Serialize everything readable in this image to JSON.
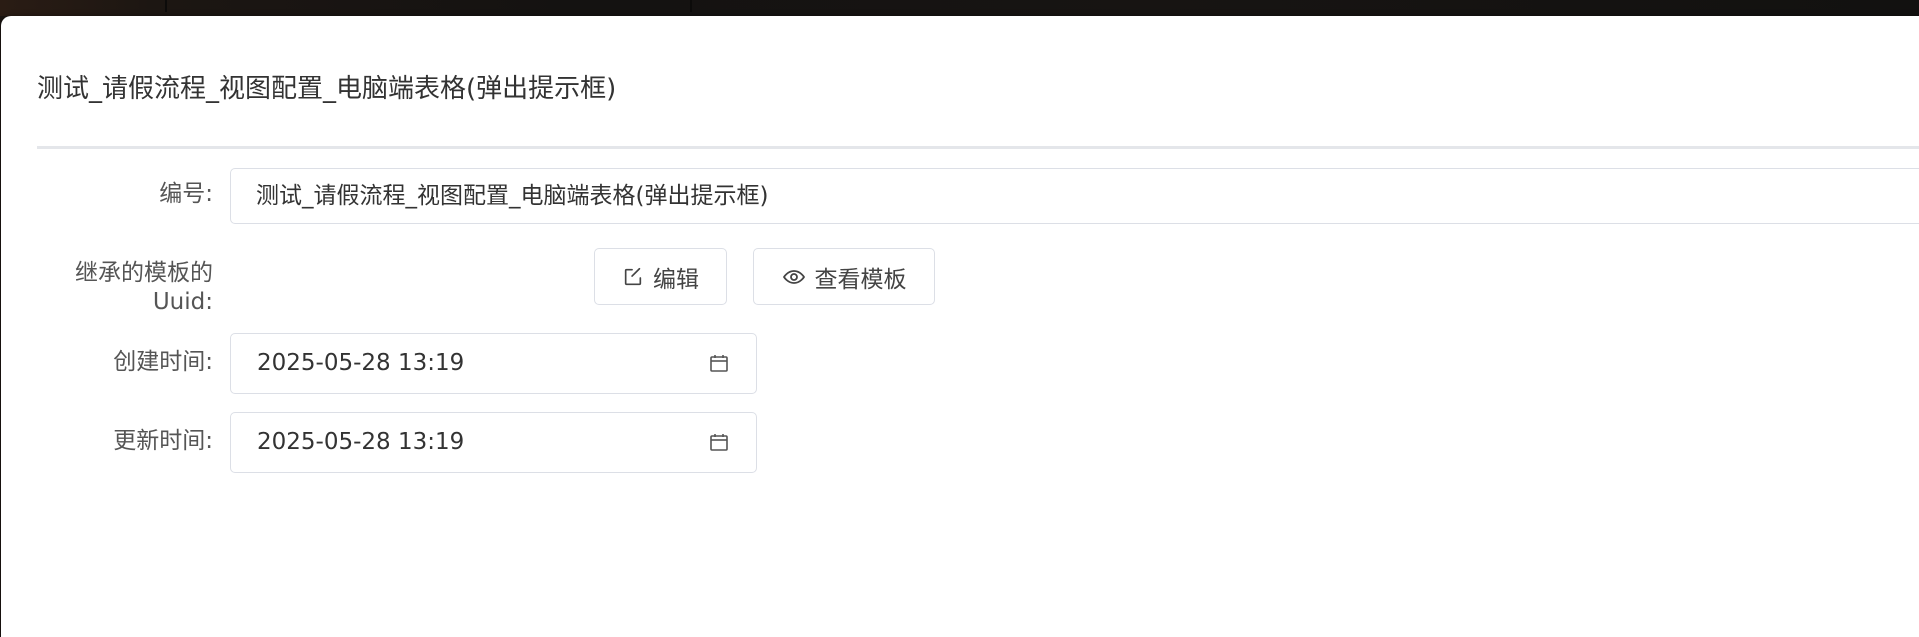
{
  "modal": {
    "title": "测试_请假流程_视图配置_电脑端表格(弹出提示框)"
  },
  "form": {
    "number": {
      "label": "编号:",
      "value": "测试_请假流程_视图配置_电脑端表格(弹出提示框)"
    },
    "template_uuid": {
      "label": "继承的模板的Uuid:",
      "edit_button": {
        "label": "编辑",
        "icon": "edit-icon"
      },
      "view_button": {
        "label": "查看模板",
        "icon": "eye-icon"
      }
    },
    "created_time": {
      "label": "创建时间:",
      "value": "2025-05-28 13:19",
      "icon": "calendar-icon"
    },
    "updated_time": {
      "label": "更新时间:",
      "value": "2025-05-28 13:19",
      "icon": "calendar-icon"
    }
  },
  "colors": {
    "border": "#dcdfe6",
    "text": "#333333",
    "label": "#555555",
    "divider": "#e4e6ea"
  }
}
